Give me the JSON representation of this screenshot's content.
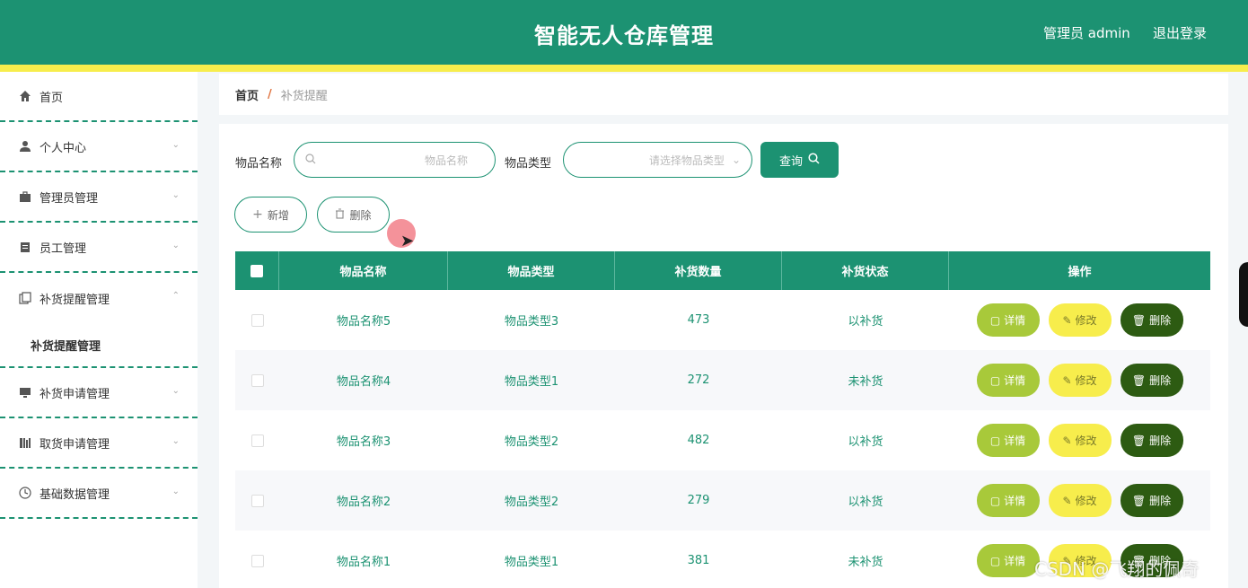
{
  "header": {
    "title": "智能无人仓库管理",
    "user_label": "管理员 admin",
    "logout_label": "退出登录",
    "accent_color": "#1c9272",
    "strip_color": "#f7ed4c"
  },
  "sidebar": {
    "items": [
      {
        "label": "首页",
        "icon": "home-icon"
      },
      {
        "label": "个人中心",
        "icon": "user-icon"
      },
      {
        "label": "管理员管理",
        "icon": "briefcase-icon"
      },
      {
        "label": "员工管理",
        "icon": "clipboard-icon"
      },
      {
        "label": "补货提醒管理",
        "icon": "copy-icon",
        "expanded": true
      },
      {
        "label": "补货申请管理",
        "icon": "monitor-icon"
      },
      {
        "label": "取货申请管理",
        "icon": "bars-icon"
      },
      {
        "label": "基础数据管理",
        "icon": "clock-icon"
      }
    ],
    "subitem": "补货提醒管理"
  },
  "breadcrumb": {
    "home": "首页",
    "separator": "/",
    "current": "补货提醒"
  },
  "search": {
    "name_label": "物品名称",
    "name_placeholder": "物品名称",
    "type_label": "物品类型",
    "type_placeholder": "请选择物品类型",
    "button_label": "查询"
  },
  "actions": {
    "add_label": "新增",
    "delete_label": "删除"
  },
  "table": {
    "columns": [
      "物品名称",
      "物品类型",
      "补货数量",
      "补货状态",
      "操作"
    ],
    "rows": [
      {
        "name": "物品名称5",
        "type": "物品类型3",
        "qty": "473",
        "status": "以补货"
      },
      {
        "name": "物品名称4",
        "type": "物品类型1",
        "qty": "272",
        "status": "未补货"
      },
      {
        "name": "物品名称3",
        "type": "物品类型2",
        "qty": "482",
        "status": "以补货"
      },
      {
        "name": "物品名称2",
        "type": "物品类型2",
        "qty": "279",
        "status": "以补货"
      },
      {
        "name": "物品名称1",
        "type": "物品类型1",
        "qty": "381",
        "status": "未补货"
      }
    ],
    "row_actions": {
      "detail": "详情",
      "edit": "修改",
      "delete": "删除"
    }
  },
  "watermark": "CSDN @飞翔的佩奇"
}
